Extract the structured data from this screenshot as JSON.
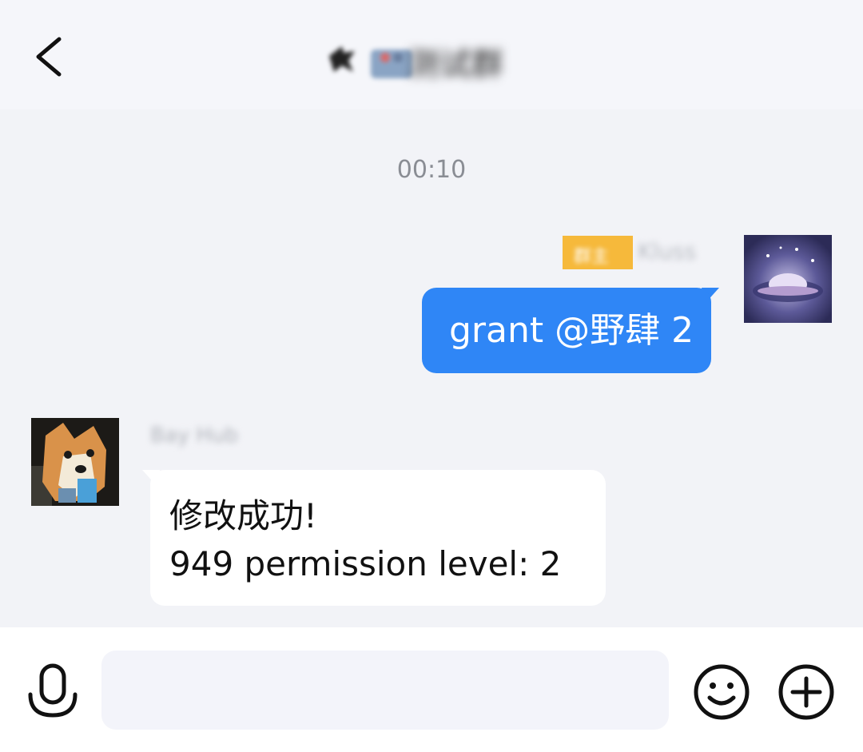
{
  "header": {
    "title": "测试群"
  },
  "chat": {
    "timestamp": "00:10",
    "messages": [
      {
        "direction": "outgoing",
        "badge": "群主",
        "sender": "Kluss",
        "text": "grant @野肆 2",
        "avatar_icon": "planet-avatar-icon"
      },
      {
        "direction": "incoming",
        "sender": "Bay Hub",
        "lines": [
          "修改成功!",
          "949 permission level: 2"
        ],
        "avatar_icon": "shiba-avatar-icon"
      }
    ]
  },
  "input_bar": {
    "placeholder": "",
    "value": "",
    "icons": [
      "microphone-icon",
      "smiley-icon",
      "plus-circle-icon"
    ]
  },
  "colors": {
    "header_bg": "#f5f6fa",
    "chat_bg": "#f2f3f7",
    "outgoing_bubble": "#2f86f6",
    "incoming_bubble": "#ffffff",
    "badge": "#f6b93b"
  }
}
